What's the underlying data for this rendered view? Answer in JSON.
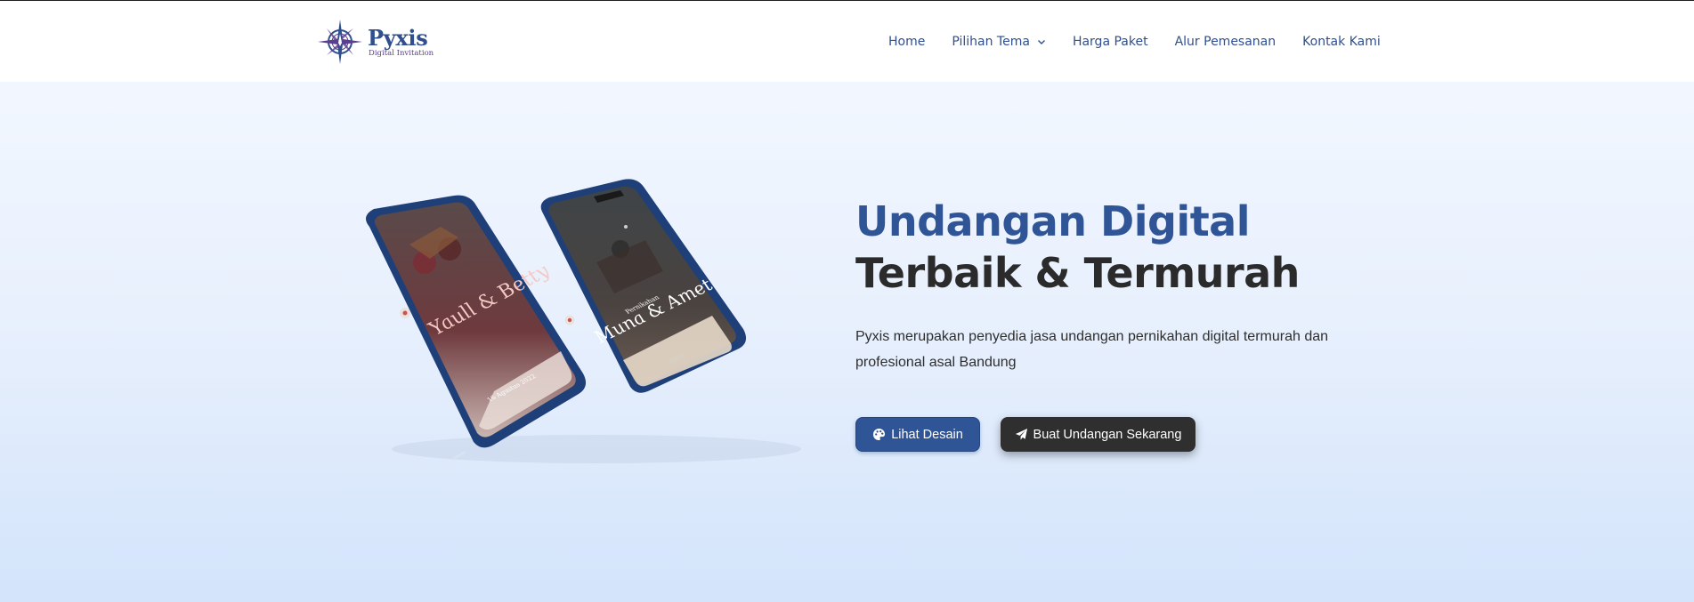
{
  "brand": {
    "name": "Pyxis",
    "tagline": "Digital Invitation"
  },
  "nav": {
    "items": [
      {
        "label": "Home"
      },
      {
        "label": "Pilihan Tema",
        "has_dropdown": true
      },
      {
        "label": "Harga Paket"
      },
      {
        "label": "Alur Pemesanan"
      },
      {
        "label": "Kontak Kami"
      }
    ]
  },
  "hero": {
    "title_line1": "Undangan Digital",
    "title_line2": "Terbaik & Termurah",
    "description": "Pyxis merupakan penyedia jasa undangan pernikahan digital termurah dan profesional asal Bandung",
    "primary_button": {
      "label": "Lihat Desain",
      "icon": "palette-icon"
    },
    "secondary_button": {
      "label": "Buat Undangan Sekarang",
      "icon": "paper-plane-icon"
    }
  },
  "mockups": {
    "left_phone": {
      "names": "Yaull & Betty",
      "date": "16 Agustus 2022"
    },
    "right_phone": {
      "heading": "Pernikahan",
      "names": "Muna & Amet"
    }
  },
  "colors": {
    "brand_blue": "#2f5597",
    "dark": "#2b2b2b",
    "hero_gradient_top": "#f2f7ff",
    "hero_gradient_bottom": "#d3e4fb"
  }
}
